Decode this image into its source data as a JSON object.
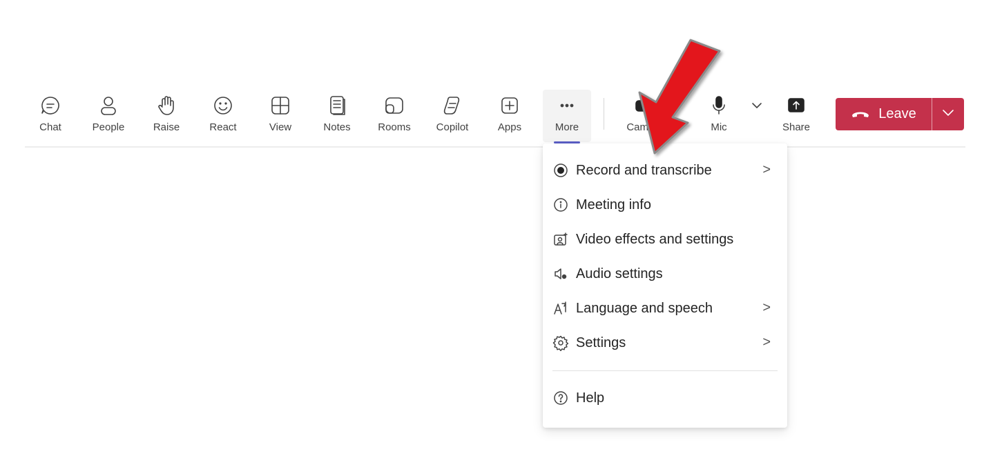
{
  "toolbar": {
    "buttons": [
      {
        "label": "Chat",
        "icon": "chat-icon"
      },
      {
        "label": "People",
        "icon": "people-icon"
      },
      {
        "label": "Raise",
        "icon": "raise-hand-icon"
      },
      {
        "label": "React",
        "icon": "smile-icon"
      },
      {
        "label": "View",
        "icon": "grid-view-icon"
      },
      {
        "label": "Notes",
        "icon": "notes-icon"
      },
      {
        "label": "Rooms",
        "icon": "rooms-icon"
      },
      {
        "label": "Copilot",
        "icon": "copilot-icon"
      },
      {
        "label": "Apps",
        "icon": "add-app-icon"
      },
      {
        "label": "More",
        "icon": "more-dots-icon",
        "active": true
      }
    ],
    "camera_label": "Camera",
    "mic_label": "Mic",
    "share_label": "Share",
    "leave_label": "Leave"
  },
  "menu": {
    "items": [
      {
        "label": "Record and transcribe",
        "icon": "record-icon",
        "submenu": true
      },
      {
        "label": "Meeting info",
        "icon": "info-icon",
        "submenu": false
      },
      {
        "label": "Video effects and settings",
        "icon": "video-effects-icon",
        "submenu": false
      },
      {
        "label": "Audio settings",
        "icon": "audio-settings-icon",
        "submenu": false
      },
      {
        "label": "Language and speech",
        "icon": "language-icon",
        "submenu": true
      },
      {
        "label": "Settings",
        "icon": "gear-icon",
        "submenu": true
      }
    ],
    "help_label": "Help",
    "submenu_glyph": ">"
  },
  "colors": {
    "leave_red": "#c4314b",
    "active_underline": "#5b5fc7",
    "arrow_red": "#e3141b"
  }
}
